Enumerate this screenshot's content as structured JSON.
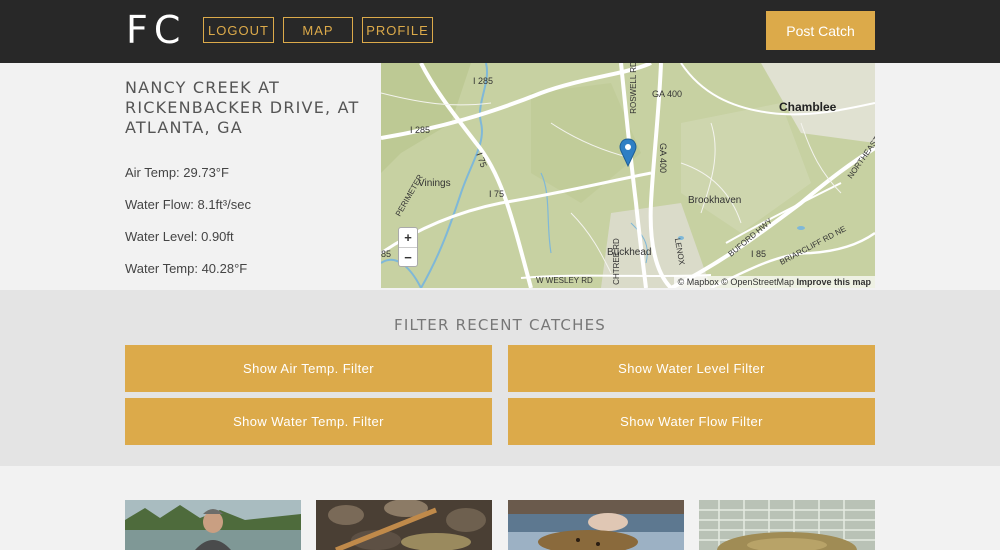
{
  "header": {
    "logo": "FC",
    "nav": [
      {
        "label": "LOGOUT"
      },
      {
        "label": "MAP"
      },
      {
        "label": "PROFILE"
      }
    ],
    "post_button": "Post Catch"
  },
  "site": {
    "title": "NANCY CREEK AT RICKENBACKER DRIVE, AT ATLANTA, GA",
    "stats": [
      {
        "label": "Air Temp: 29.73°F"
      },
      {
        "label": "Water Flow: 8.1ft³/sec"
      },
      {
        "label": "Water Level: 0.90ft"
      },
      {
        "label": "Water Temp: 40.28°F"
      }
    ]
  },
  "map": {
    "places": {
      "chamblee": "Chamblee",
      "brookhaven": "Brookhaven",
      "buckhead": "Buckhead",
      "vinings": "Vinings"
    },
    "roads": {
      "i285_a": "I 285",
      "i285_b": "I 285",
      "i75_a": "I 75",
      "i75_b": "I 75",
      "ga400_a": "GA 400",
      "ga400_b": "GA 400",
      "i85": "I 85",
      "wesley": "W WESLEY RD",
      "perimeter": "PERIMETER",
      "roswell": "ROSWELL RD",
      "buford": "BUFORD HWY",
      "briarcliff": "BRIARCLIFF RD NE",
      "northeast": "NORTHEAST",
      "lenox": "LENOX",
      "edge85": "85",
      "peachtree": "CHTREE RD"
    },
    "zoom_in": "+",
    "zoom_out": "−",
    "attribution_prefix": "© Mapbox © OpenStreetMap ",
    "attribution_link": "Improve this map"
  },
  "filter": {
    "title": "FILTER RECENT CATCHES",
    "buttons": [
      {
        "label": "Show Air Temp. Filter"
      },
      {
        "label": "Show Water Level Filter"
      },
      {
        "label": "Show Water Temp. Filter"
      },
      {
        "label": "Show Water Flow Filter"
      }
    ]
  },
  "colors": {
    "header_bg": "#282828",
    "accent": "#dcaa4a",
    "filter_bg": "#e4e4e4",
    "page_bg": "#f2f2f2"
  }
}
